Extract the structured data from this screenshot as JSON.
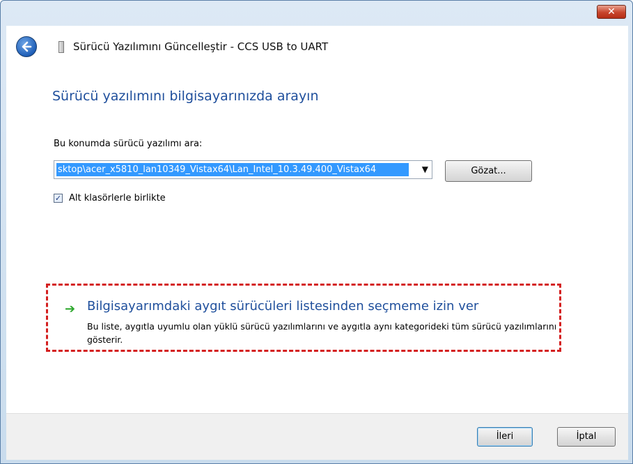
{
  "window": {
    "title": "Sürücü Yazılımını Güncelleştir - CCS USB to UART",
    "close_label": "✕"
  },
  "content": {
    "heading": "Sürücü yazılımını bilgisayarınızda arayın",
    "search_label": "Bu konumda sürücü yazılımı ara:",
    "path_value": "sktop\\acer_x5810_lan10349_Vistax64\\Lan_Intel_10.3.49.400_Vistax64",
    "browse_label": "Gözat...",
    "include_subfolders": {
      "label": "Alt klasörlerle birlikte",
      "checked": true,
      "mark": "✓"
    },
    "pick_option": {
      "icon": "green-arrow-icon",
      "arrow_glyph": "➔",
      "title": "Bilgisayarımdaki aygıt sürücüleri listesinden seçmeme izin ver",
      "description": "Bu liste, aygıtla uyumlu olan yüklü sürücü yazılımlarını ve aygıtla aynı kategorideki tüm sürücü yazılımlarını gösterir."
    }
  },
  "footer": {
    "next_label": "İleri",
    "cancel_label": "İptal"
  },
  "colors": {
    "heading": "#1f4f9c",
    "selection": "#3399ff",
    "highlight_border": "#d42020",
    "arrow": "#2ea82e"
  }
}
